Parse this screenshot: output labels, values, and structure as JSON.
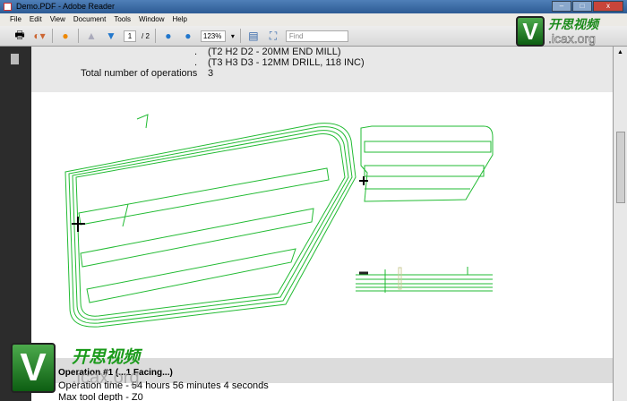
{
  "window": {
    "title": "Demo.PDF - Adobe Reader"
  },
  "menu": [
    "File",
    "Edit",
    "View",
    "Document",
    "Tools",
    "Window",
    "Help"
  ],
  "toolbar": {
    "page_current": "1",
    "page_total": "/ 2",
    "zoom": "123%",
    "find_placeholder": "Find"
  },
  "document": {
    "tool_line_2": "(T2 H2 D2 - 20MM END MILL)",
    "tool_line_3": "(T3 H3 D3 - 12MM DRILL, 118 INC)",
    "total_ops_label": "Total number of operations",
    "total_ops_value": "3",
    "bullet": ".",
    "op_title": "Operation #1 (...1 Facing...)",
    "op_time": "Operation time - 54 hours 56 minutes 4 seconds",
    "max_depth": "Max tool depth - Z0"
  },
  "watermark": {
    "letter": "V",
    "chinese": "开思视频",
    "site": ".icax.org"
  },
  "colors": {
    "toolpath": "#22bb33",
    "title_bar": "#3a6aa6"
  }
}
